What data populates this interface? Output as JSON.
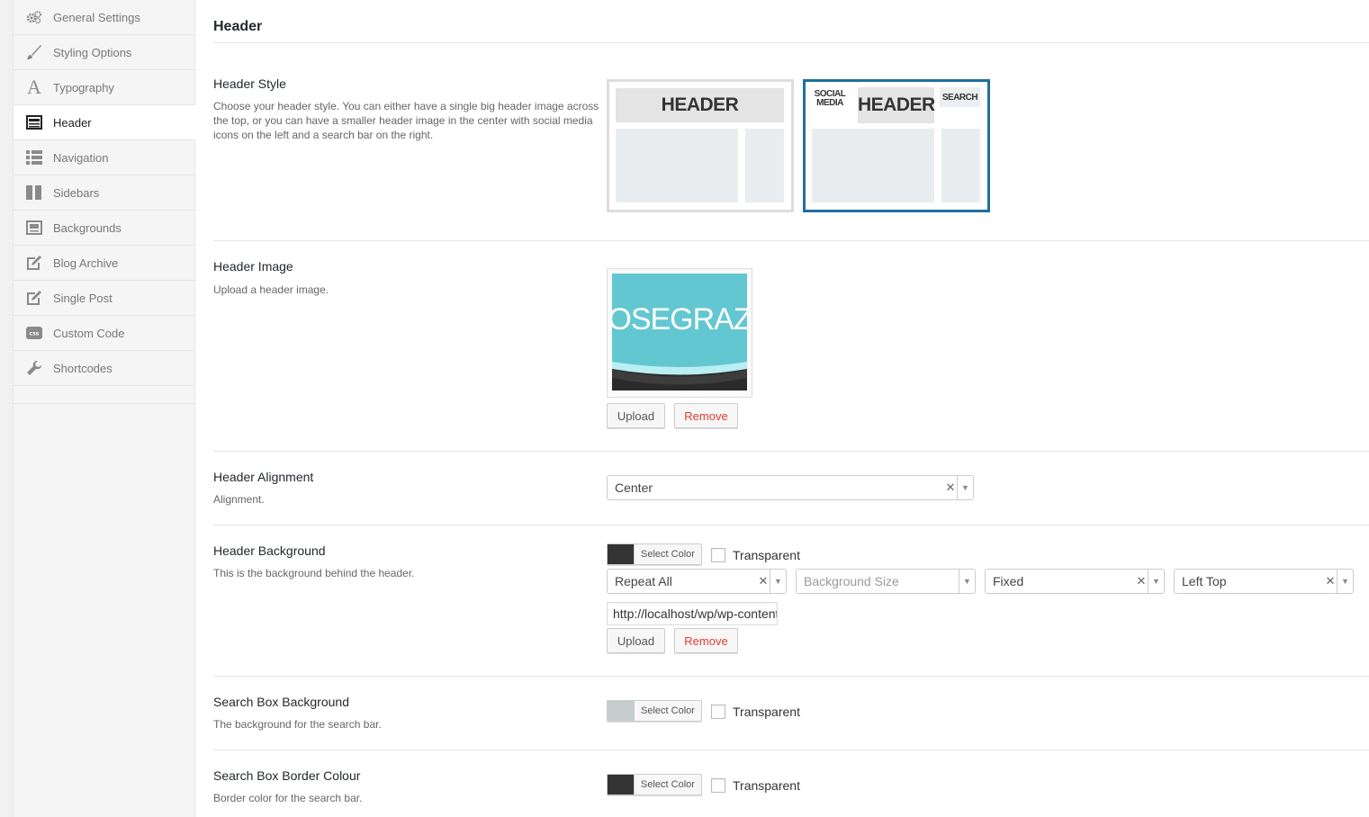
{
  "sidebar": {
    "items": [
      {
        "label": "General Settings",
        "icon": "gears-icon"
      },
      {
        "label": "Styling Options",
        "icon": "brush-icon"
      },
      {
        "label": "Typography",
        "icon": "typography-icon"
      },
      {
        "label": "Header",
        "icon": "header-layout-icon",
        "active": true
      },
      {
        "label": "Navigation",
        "icon": "list-icon"
      },
      {
        "label": "Sidebars",
        "icon": "columns-icon"
      },
      {
        "label": "Backgrounds",
        "icon": "background-icon"
      },
      {
        "label": "Blog Archive",
        "icon": "edit-icon"
      },
      {
        "label": "Single Post",
        "icon": "edit-icon"
      },
      {
        "label": "Custom Code",
        "icon": "css-icon"
      },
      {
        "label": "Shortcodes",
        "icon": "wrench-icon"
      }
    ]
  },
  "page": {
    "title": "Header"
  },
  "header_style": {
    "title": "Header Style",
    "desc": "Choose your header style. You can either have a single big header image across the top, or you can have a smaller header image in the center with social media icons on the left and a search bar on the right.",
    "option1_label": "HEADER",
    "option2_label": "HEADER",
    "option2_social": "SOCIAL MEDIA",
    "option2_search": "SEARCH",
    "selected": 2,
    "selected_color": "#1e6fa0"
  },
  "header_image": {
    "title": "Header Image",
    "desc": "Upload a header image.",
    "preview_text": "OSEGRAZ",
    "upload_label": "Upload",
    "remove_label": "Remove"
  },
  "header_alignment": {
    "title": "Header Alignment",
    "desc": "Alignment.",
    "value": "Center"
  },
  "header_background": {
    "title": "Header Background",
    "desc": "This is the background behind the header.",
    "color": "#333333",
    "select_color_label": "Select Color",
    "transparent_label": "Transparent",
    "repeat": "Repeat All",
    "size_placeholder": "Background Size",
    "attachment": "Fixed",
    "position": "Left Top",
    "url": "http://localhost/wp/wp-content/uploads/header-bg.png",
    "upload_label": "Upload",
    "remove_label": "Remove"
  },
  "search_box_background": {
    "title": "Search Box Background",
    "desc": "The background for the search bar.",
    "color": "#c5cccc",
    "select_color_label": "Select Color",
    "transparent_label": "Transparent"
  },
  "search_box_border": {
    "title": "Search Box Border Colour",
    "desc": "Border color for the search bar.",
    "color": "#333333",
    "select_color_label": "Select Color",
    "transparent_label": "Transparent"
  }
}
